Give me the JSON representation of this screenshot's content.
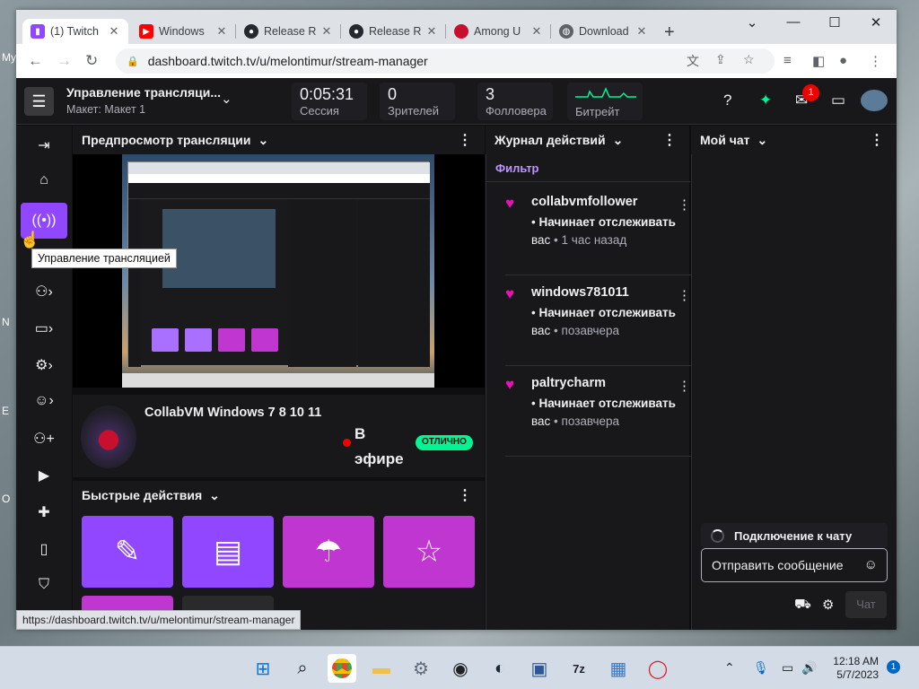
{
  "browser": {
    "tabs": [
      {
        "title": "(1) Twitch",
        "active": true
      },
      {
        "title": "Windows",
        "active": false
      },
      {
        "title": "Release R",
        "active": false
      },
      {
        "title": "Release R",
        "active": false
      },
      {
        "title": "Among U",
        "active": false
      },
      {
        "title": "Download",
        "active": false
      }
    ],
    "url": "dashboard.twitch.tv/u/melontimur/stream-manager",
    "status_url": "https://dashboard.twitch.tv/u/melontimur/stream-manager"
  },
  "header": {
    "title": "Управление трансляци...",
    "layout": "Макет: Макет 1",
    "stats": [
      {
        "value": "0:05:31",
        "label": "Сессия"
      },
      {
        "value": "0",
        "label": "Зрителей"
      },
      {
        "value": "3",
        "label": "Фолловера"
      },
      {
        "value": "",
        "label": "Битрейт"
      }
    ],
    "notifications_count": "1"
  },
  "sidebar": {
    "tooltip": "Управление трансляцией"
  },
  "preview": {
    "title": "Предпросмотр трансляции"
  },
  "stream": {
    "title": "CollabVM Windows 7 8 10 11",
    "live_label": "В эфире",
    "health_badge": "ОТЛИЧНО"
  },
  "quick_actions": {
    "title": "Быстрые действия",
    "colors": {
      "primary": "#9147ff",
      "secondary": "#bf36d1"
    }
  },
  "activity": {
    "title": "Журнал действий",
    "filter": "Фильтр",
    "items": [
      {
        "user": "collabvmfollower",
        "action": "Начинает отслеживать",
        "target": "вас",
        "time": "1 час назад"
      },
      {
        "user": "windows781011",
        "action": "Начинает отслеживать",
        "target": "вас",
        "time": "позавчера"
      },
      {
        "user": "paltrycharm",
        "action": "Начинает отслеживать",
        "target": "вас",
        "time": "позавчера"
      }
    ]
  },
  "chat": {
    "title": "Мой чат",
    "connecting": "Подключение к чату",
    "placeholder": "Отправить сообщение",
    "send_button": "Чат"
  },
  "taskbar": {
    "time": "12:18 AM",
    "date": "5/7/2023",
    "notifications": "1"
  },
  "desktop": {
    "icon_labels": [
      "My",
      "N",
      "E",
      "O"
    ]
  }
}
